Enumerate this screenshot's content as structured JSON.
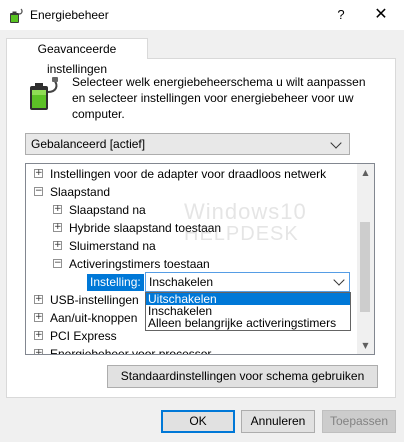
{
  "window": {
    "title": "Energiebeheer",
    "help_glyph": "?",
    "close_glyph": "✕",
    "icon": "battery-plug-icon"
  },
  "tab": {
    "label": "Geavanceerde instellingen"
  },
  "description": "Selecteer welk energiebeheerschema u wilt aanpassen en selecteer instellingen voor energiebeheer voor uw computer.",
  "scheme_select": {
    "value": "Gebalanceerd [actief]"
  },
  "tree": {
    "items": [
      {
        "label": "Instellingen voor de adapter voor draadloos netwerk",
        "expander": "+"
      },
      {
        "label": "Slaapstand",
        "expander": "−"
      },
      {
        "label": "Slaapstand na",
        "expander": "+"
      },
      {
        "label": "Hybride slaapstand toestaan",
        "expander": "+"
      },
      {
        "label": "Sluimerstand na",
        "expander": "+"
      },
      {
        "label": "Activeringstimers toestaan",
        "expander": "−"
      },
      {
        "label": "USB-instellingen",
        "expander": "+"
      },
      {
        "label": "Aan/uit-knoppen",
        "expander": "+"
      },
      {
        "label": "PCI Express",
        "expander": "+"
      },
      {
        "label": "Energiebeheer voor processor",
        "expander": "+"
      }
    ],
    "setting_label": "Instelling:",
    "setting_value": "Inschakelen",
    "options": [
      "Uitschakelen",
      "Inschakelen",
      "Alleen belangrijke activeringstimers"
    ],
    "selected_option_index": 0
  },
  "watermark": {
    "line1": "Windows10",
    "line2": "HELPDESK"
  },
  "buttons": {
    "restore_defaults": "Standaardinstellingen voor schema gebruiken",
    "ok": "OK",
    "cancel": "Annuleren",
    "apply": "Toepassen"
  },
  "colors": {
    "accent": "#0078d7",
    "window_bg": "#f0f0f0"
  }
}
